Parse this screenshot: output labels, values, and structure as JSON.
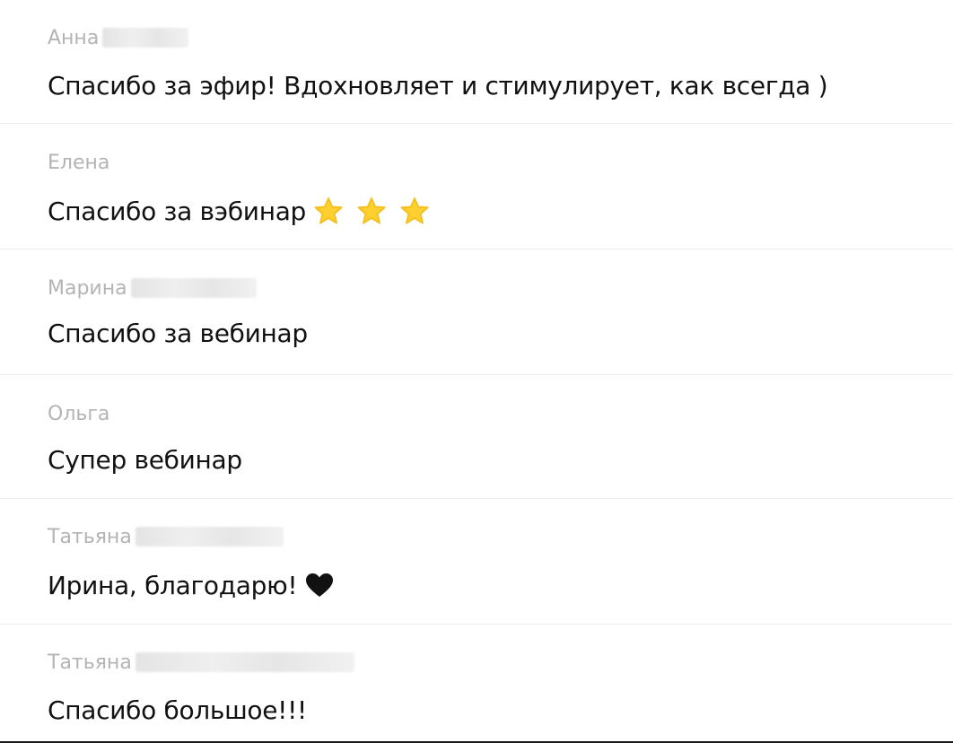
{
  "comments": [
    {
      "author": "Анна",
      "author_hidden": true,
      "text": "Спасибо за эфир! Вдохновляет и стимулирует, как всегда )",
      "emoji": []
    },
    {
      "author": "Елена",
      "author_hidden": false,
      "text": "Спасибо за вэбинар",
      "emoji": [
        "star-icon",
        "star-icon",
        "star-icon"
      ]
    },
    {
      "author": "Марина",
      "author_hidden": true,
      "text": "Спасибо за вебинар",
      "emoji": []
    },
    {
      "author": "Ольга",
      "author_hidden": false,
      "text": "Супер вебинар",
      "emoji": []
    },
    {
      "author": "Татьяна",
      "author_hidden": true,
      "text": "Ирина, благодарю!",
      "emoji": [
        "heart-icon"
      ]
    },
    {
      "author": "Татьяна",
      "author_hidden": true,
      "text": "Спасибо большое!!!",
      "emoji": []
    }
  ],
  "colors": {
    "author": "#b4b4b4",
    "message": "#111111",
    "divider": "#ececec",
    "star": "#ffd02e",
    "heart": "#111111"
  }
}
